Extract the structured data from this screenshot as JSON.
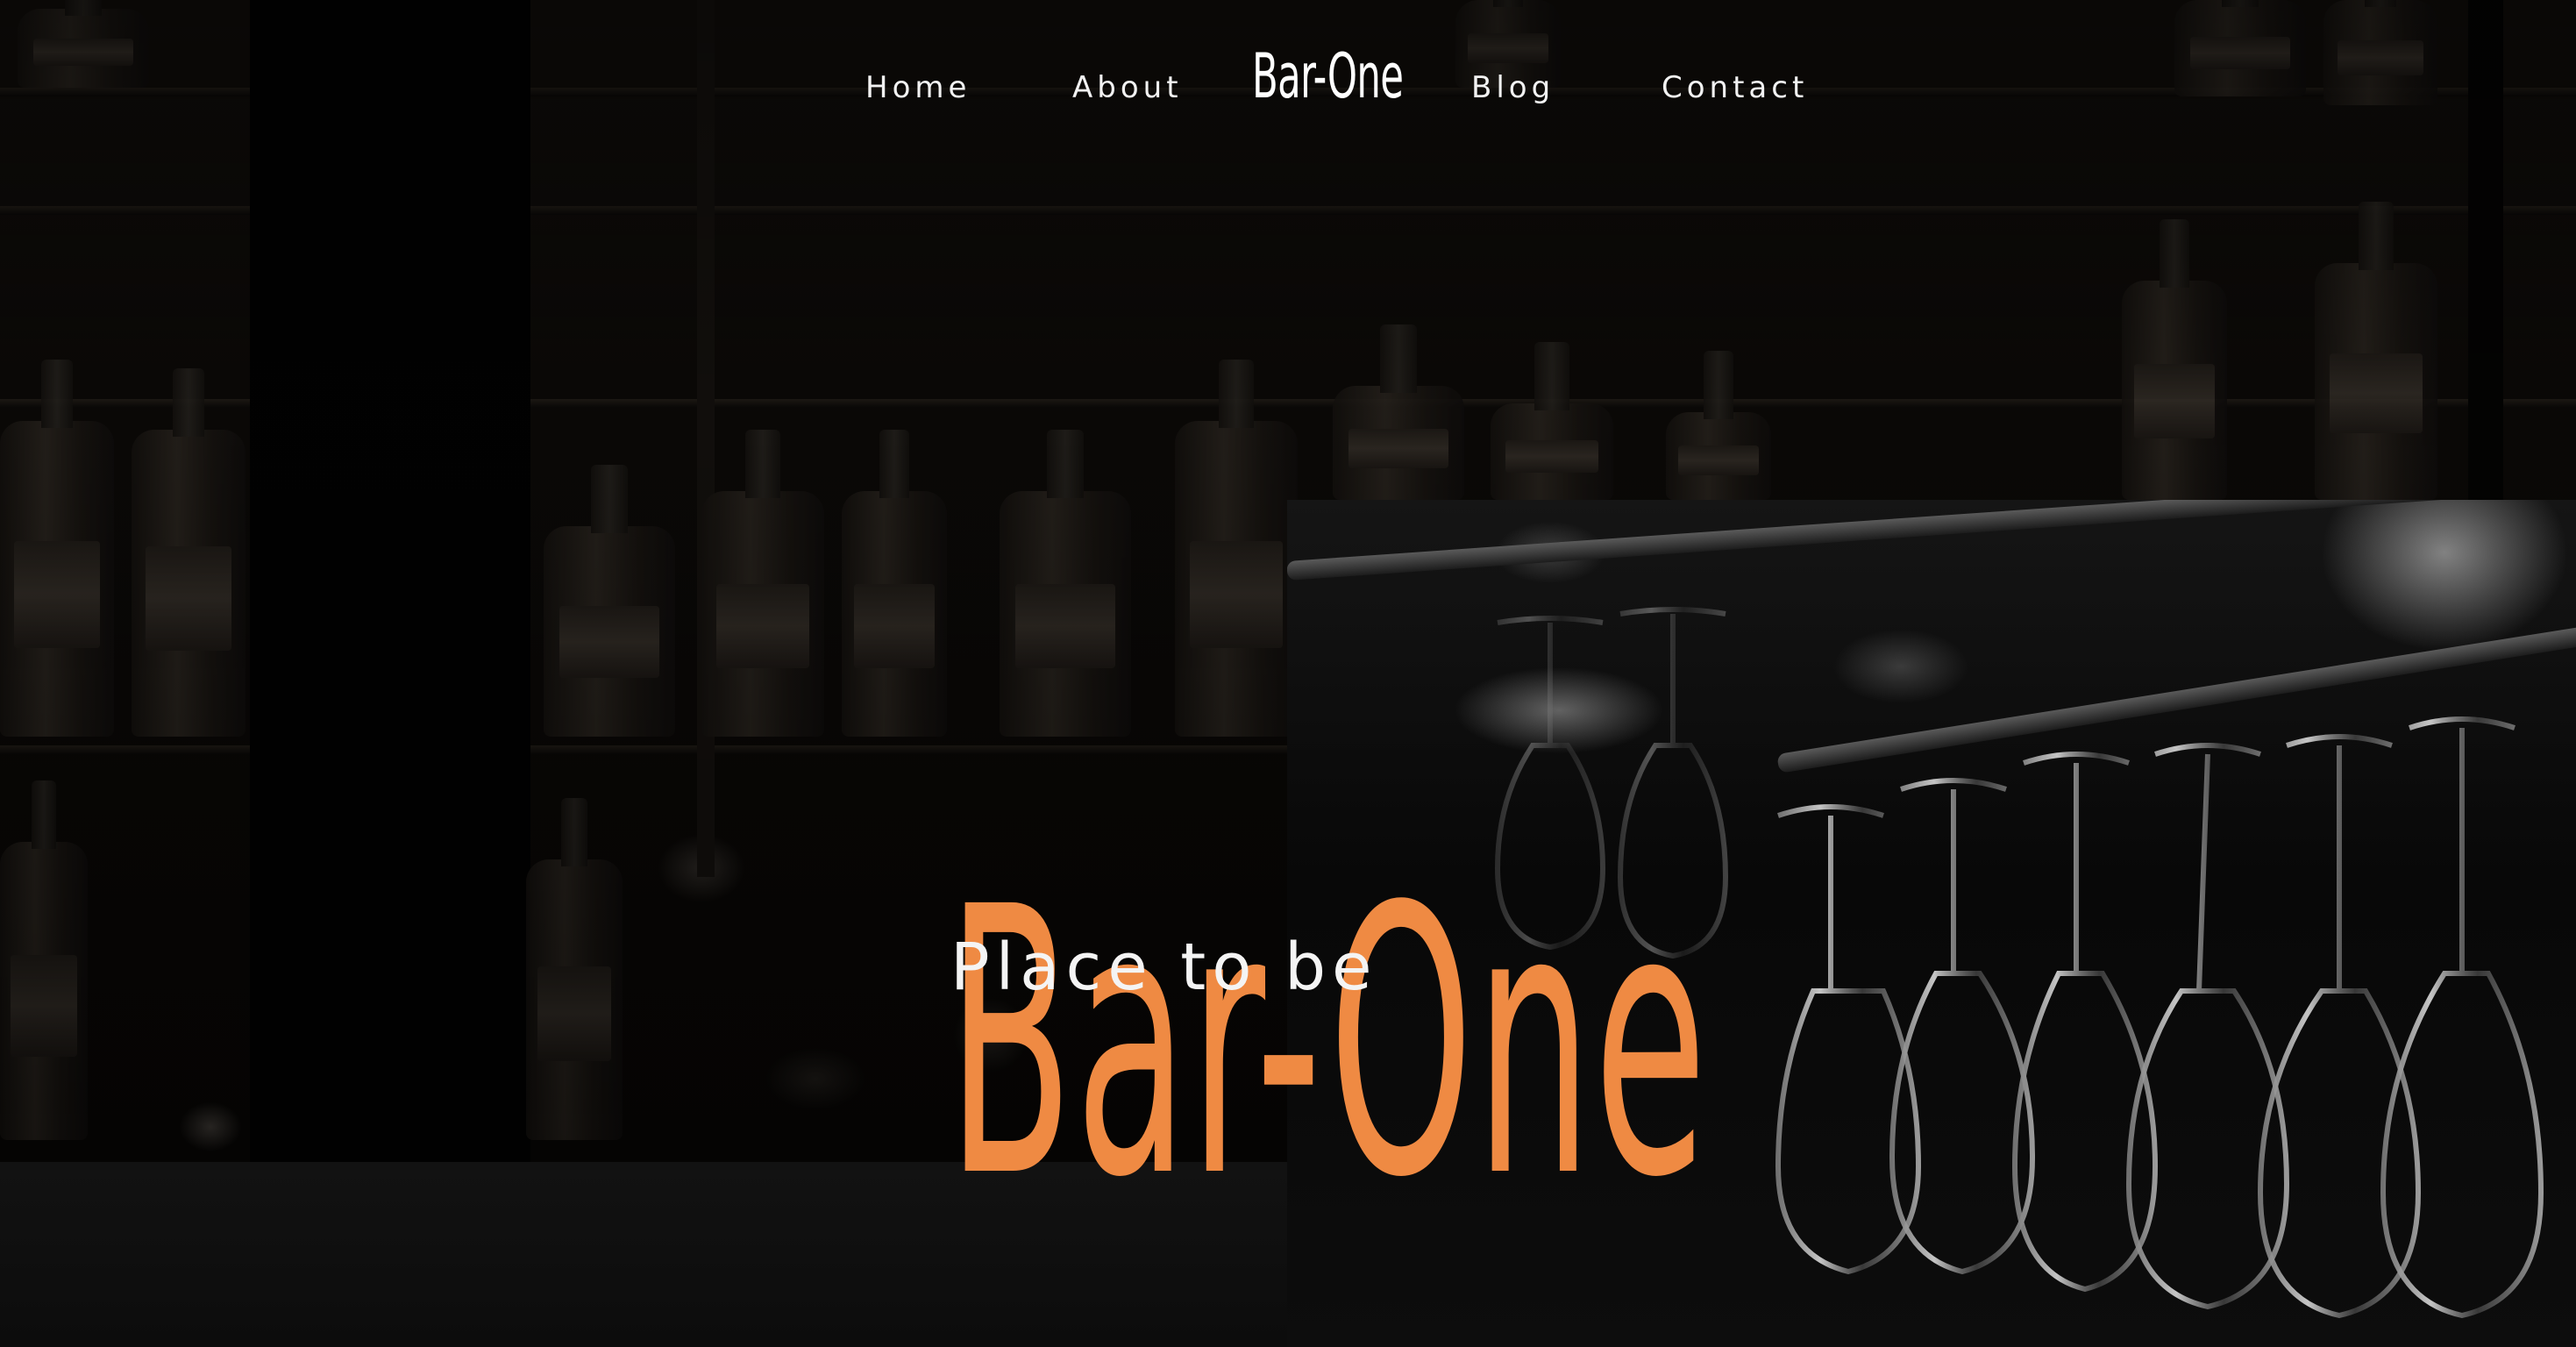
{
  "nav": {
    "home": "Home",
    "about": "About",
    "logo": "Bar-One",
    "blog": "Blog",
    "contact": "Contact"
  },
  "hero": {
    "title": "Bar-One",
    "subtitle": "Place to be"
  },
  "colors": {
    "accent": "#ef8a43",
    "nav_text": "#f2f2f2",
    "panel": "#101010"
  }
}
